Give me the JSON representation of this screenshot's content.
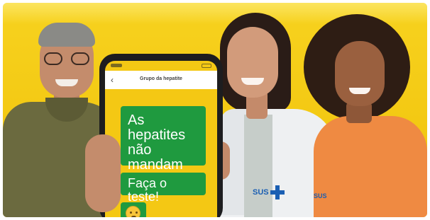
{
  "chat": {
    "title": "Grupo da hepatite",
    "messages": [
      {
        "text": "As hepatites não mandam mensagem."
      },
      {
        "text": "Faça o teste!"
      },
      {
        "emoji": "worried-face-emoji"
      }
    ]
  },
  "brand": {
    "coat_logo": "SUS",
    "sleeve_logo": "SUS",
    "logo_color": "#1b5fb3"
  },
  "colors": {
    "background": "#f3c913",
    "bubble": "#1f9a3f",
    "phone_screen": "#f4c814"
  }
}
